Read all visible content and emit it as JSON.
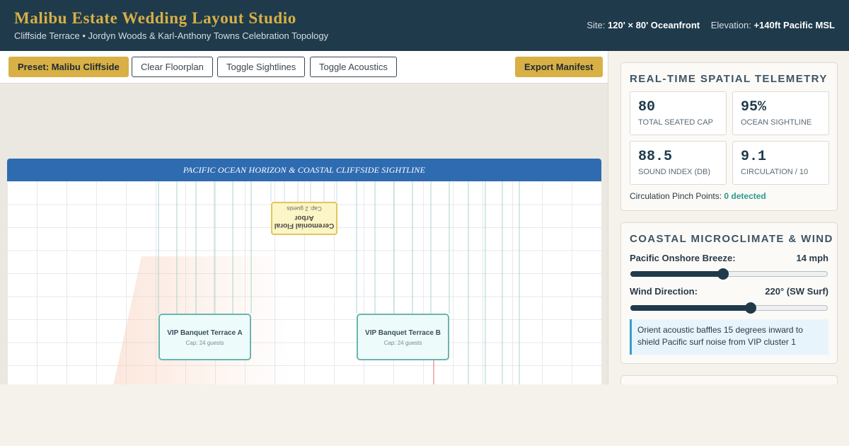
{
  "header": {
    "title": "Malibu Estate Wedding Layout Studio",
    "subtitle": "Cliffside Terrace • Jordyn Woods & Karl-Anthony Towns Celebration Topology",
    "site_label": "Site:",
    "site_value": "120' × 80' Oceanfront",
    "elevation_label": "Elevation:",
    "elevation_value": "+140ft Pacific MSL"
  },
  "toolbar": {
    "preset_label": "Preset: Malibu Cliffside",
    "clear_label": "Clear Floorplan",
    "sightlines_label": "Toggle Sightlines",
    "acoustics_label": "Toggle Acoustics",
    "export_label": "Export Manifest"
  },
  "floorplan": {
    "banner": "PACIFIC OCEAN HORIZON & COASTAL CLIFFSIDE SIGHTLINE",
    "arbor": {
      "name": "Ceremonial Floral Arbor",
      "cap": "Cap: 2 guests"
    },
    "tables": [
      {
        "name": "VIP Banquet Terrace A",
        "cap": "Cap: 24 guests"
      },
      {
        "name": "VIP Banquet Terrace B",
        "cap": "Cap: 24 guests"
      }
    ]
  },
  "telemetry": {
    "title": "REAL-TIME SPATIAL TELEMETRY",
    "metrics": [
      {
        "value": "80",
        "label": "TOTAL SEATED CAP"
      },
      {
        "value": "95%",
        "label": "OCEAN SIGHTLINE"
      },
      {
        "value": "88.5",
        "label": "SOUND INDEX (DB)"
      },
      {
        "value": "9.1",
        "label": "CIRCULATION / 10"
      }
    ],
    "pinch_label": "Circulation Pinch Points:",
    "pinch_value": "0 detected"
  },
  "microclimate": {
    "title": "COASTAL MICROCLIMATE & WIND",
    "breeze_label": "Pacific Onshore Breeze:",
    "breeze_value": "14 mph",
    "breeze_level": 0.47,
    "direction_label": "Wind Direction:",
    "direction_value": "220° (SW Surf)",
    "direction_level": 0.61,
    "note": "Orient acoustic baffles 15 degrees inward to shield Pacific surf noise from VIP cluster 1"
  },
  "colors": {
    "header_bg": "#1f3a4b",
    "accent_gold": "#d8b045",
    "banner_blue": "#2e6bb1",
    "table_teal": "#6bb5ad",
    "ok_green": "#2f9a8a"
  }
}
